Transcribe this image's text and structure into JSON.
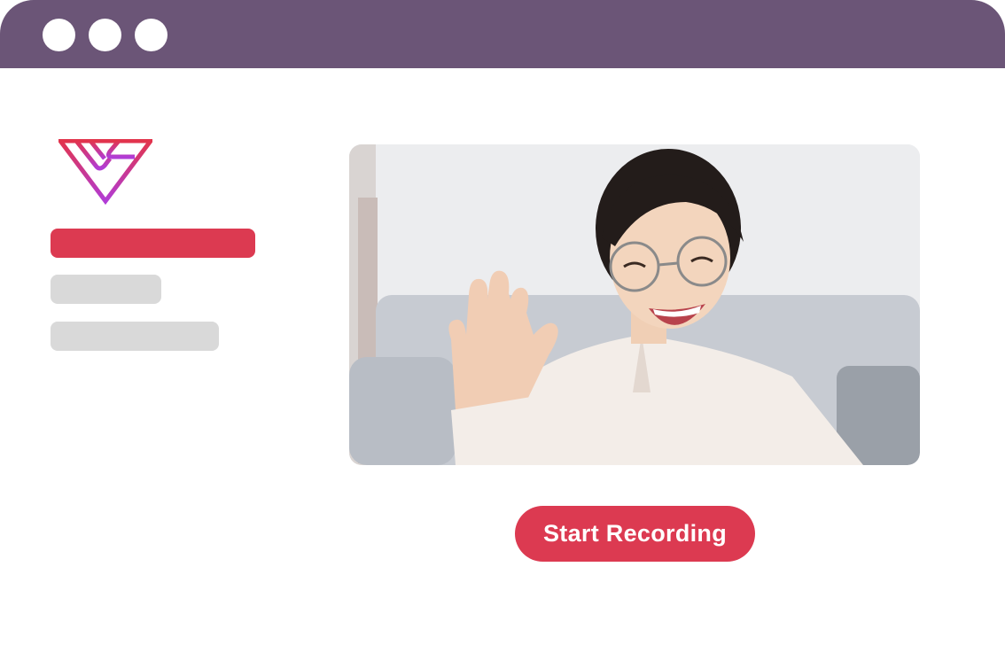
{
  "window": {
    "titlebar_color": "#6b5577",
    "controls": [
      "window-control-dot",
      "window-control-dot",
      "window-control-dot"
    ]
  },
  "sidebar": {
    "logo": "brand-logo",
    "items": [
      {
        "state": "active",
        "color": "#dc3a51"
      },
      {
        "state": "inactive",
        "color": "#d9d9d9"
      },
      {
        "state": "inactive",
        "color": "#d9d9d9"
      }
    ]
  },
  "video": {
    "content": "webcam-preview"
  },
  "actions": {
    "start_recording_label": "Start Recording"
  },
  "colors": {
    "accent": "#dc3a51",
    "titlebar": "#6b5577",
    "placeholder": "#d9d9d9"
  }
}
